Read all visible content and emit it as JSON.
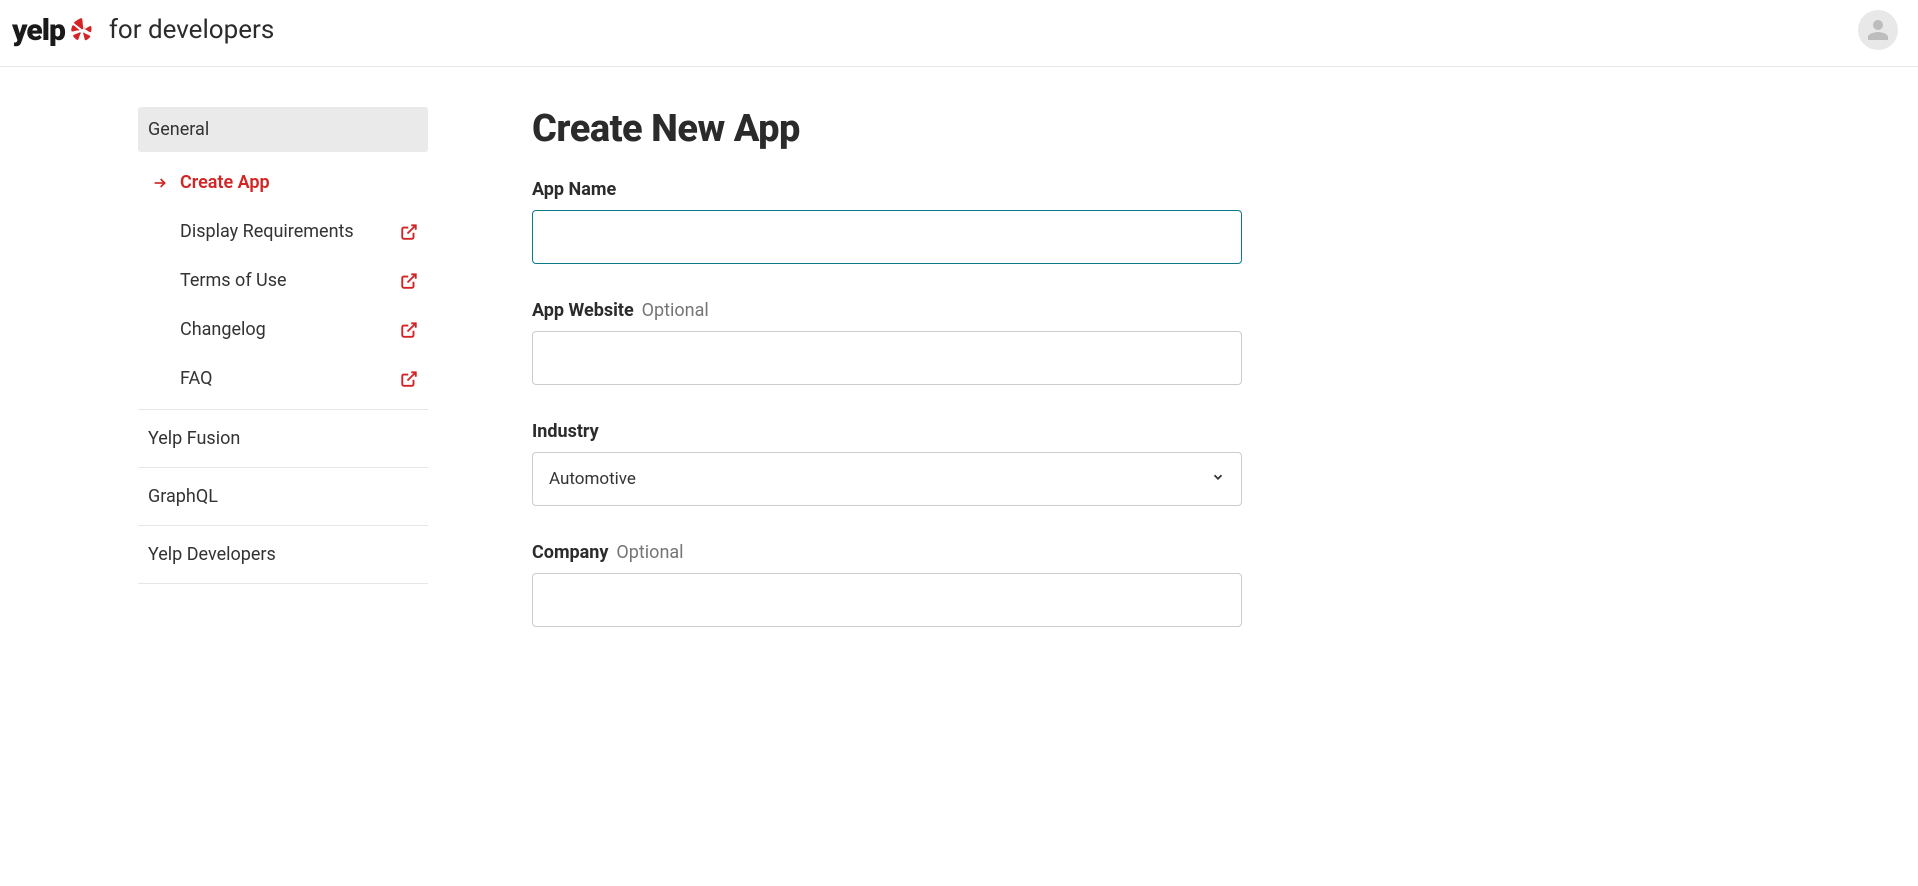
{
  "header": {
    "brand_word": "yelp",
    "brand_suffix": "for developers"
  },
  "sidebar": {
    "section_header": "General",
    "items": [
      {
        "label": "Create App",
        "active": true,
        "external": false
      },
      {
        "label": "Display Requirements",
        "active": false,
        "external": true
      },
      {
        "label": "Terms of Use",
        "active": false,
        "external": true
      },
      {
        "label": "Changelog",
        "active": false,
        "external": true
      },
      {
        "label": "FAQ",
        "active": false,
        "external": true
      }
    ],
    "top_items": [
      {
        "label": "Yelp Fusion"
      },
      {
        "label": "GraphQL"
      },
      {
        "label": "Yelp Developers"
      }
    ]
  },
  "page": {
    "title": "Create New App",
    "fields": {
      "app_name": {
        "label": "App Name",
        "optional": "",
        "value": ""
      },
      "app_website": {
        "label": "App Website",
        "optional": "Optional",
        "value": ""
      },
      "industry": {
        "label": "Industry",
        "optional": "",
        "value": "Automotive"
      },
      "company": {
        "label": "Company",
        "optional": "Optional",
        "value": ""
      }
    }
  }
}
